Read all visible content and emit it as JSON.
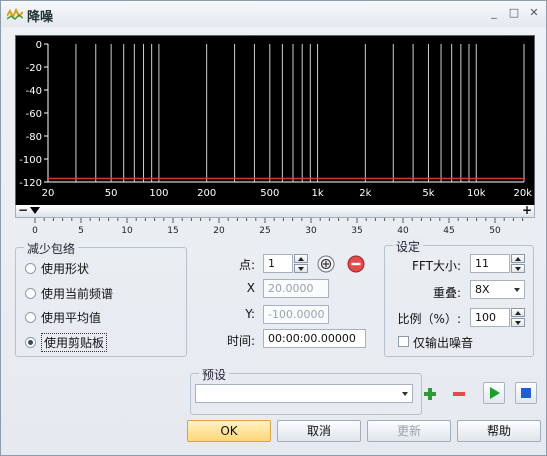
{
  "window": {
    "title": "降噪"
  },
  "graph": {
    "y_ticks": [
      "0",
      "-20",
      "-40",
      "-60",
      "-80",
      "-100",
      "-120"
    ],
    "x_labels": [
      "20",
      "50",
      "100",
      "200",
      "500",
      "1k",
      "2k",
      "5k",
      "10k",
      "20k"
    ]
  },
  "range_bar": {
    "left": "−",
    "right": "+"
  },
  "ruler": {
    "labels": [
      "0",
      "5",
      "10",
      "15",
      "20",
      "25",
      "30",
      "35",
      "40",
      "45",
      "50"
    ]
  },
  "reduce_group": {
    "title": "减少包络",
    "options": [
      "使用形状",
      "使用当前频谱",
      "使用平均值",
      "使用剪贴板"
    ],
    "selected": 3
  },
  "points": {
    "point_label": "点:",
    "point_value": "1",
    "x_label": "X",
    "x_value": "20.0000",
    "y_label": "Y:",
    "y_value": "-100.0000",
    "time_label": "时间:",
    "time_value": "00:00:00.00000"
  },
  "settings": {
    "title": "设定",
    "fft_label": "FFT大小:",
    "fft_value": "11",
    "overlap_label": "重叠:",
    "overlap_value": "8X",
    "ratio_label": "比例（%）:",
    "ratio_value": "100",
    "noise_only_label": "仅输出噪音"
  },
  "preset": {
    "title": "预设",
    "value": ""
  },
  "buttons": {
    "ok": "OK",
    "cancel": "取消",
    "update": "更新",
    "help": "帮助"
  },
  "colors": {
    "accent_ok": "#ffd775",
    "curve": "#d23c2a",
    "play": "#1a9e2e",
    "stop": "#1f5fd6",
    "add": "#2f9a3a",
    "remove": "#e24b4b"
  }
}
